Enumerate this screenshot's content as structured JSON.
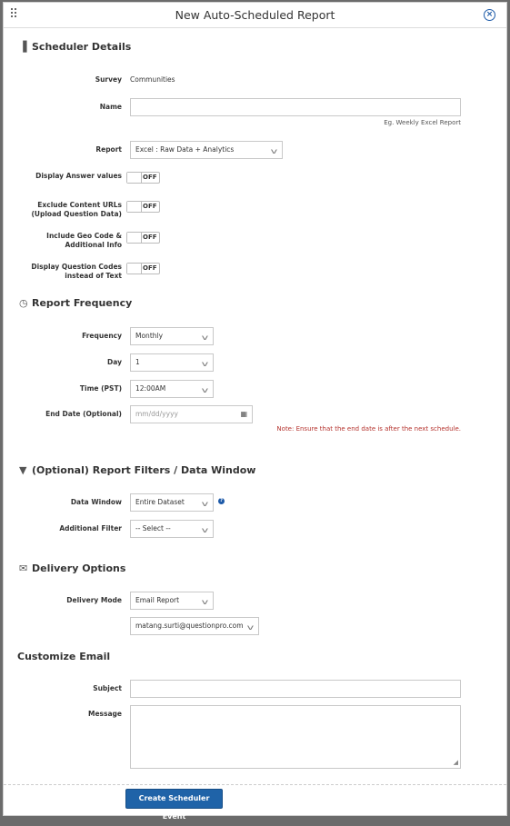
{
  "modal": {
    "title": "New Auto-Scheduled Report",
    "close": "×"
  },
  "scheduler": {
    "heading": "Scheduler Details",
    "survey_label": "Survey",
    "survey_value": "Communities",
    "name_label": "Name",
    "name_value": "",
    "name_hint": "Eg. Weekly Excel Report",
    "report_label": "Report",
    "report_value": "Excel : Raw Data + Analytics",
    "display_answer_label": "Display Answer values",
    "display_answer_state": "OFF",
    "exclude_urls_label": "Exclude Content URLs (Upload Question Data)",
    "exclude_urls_state": "OFF",
    "geo_code_label": "Include Geo Code & Additional Info",
    "geo_code_state": "OFF",
    "question_codes_label": "Display Question Codes instead of Text",
    "question_codes_state": "OFF"
  },
  "frequency": {
    "heading": "Report Frequency",
    "frequency_label": "Frequency",
    "frequency_value": "Monthly",
    "day_label": "Day",
    "day_value": "1",
    "time_label": "Time (PST)",
    "time_value": "12:00AM",
    "end_date_label": "End Date (Optional)",
    "end_date_placeholder": "mm/dd/yyyy",
    "note": "Note: Ensure that the end date is after the next schedule."
  },
  "filters": {
    "heading": "(Optional) Report Filters / Data Window",
    "data_window_label": "Data Window",
    "data_window_value": "Entire Dataset",
    "additional_filter_label": "Additional Filter",
    "additional_filter_value": "-- Select --"
  },
  "delivery": {
    "heading": "Delivery Options",
    "mode_label": "Delivery Mode",
    "mode_value": "Email Report",
    "email_value": "matang.surti@questionpro.com"
  },
  "email": {
    "heading": "Customize Email",
    "subject_label": "Subject",
    "subject_value": "",
    "message_label": "Message",
    "message_value": ""
  },
  "actions": {
    "submit_label": "Create Scheduler Event"
  }
}
